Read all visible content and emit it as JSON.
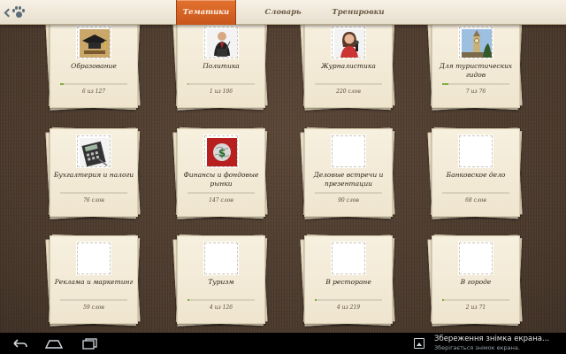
{
  "tabs": [
    {
      "label": "Тематики",
      "active": true
    },
    {
      "label": "Словарь",
      "active": false
    },
    {
      "label": "Тренировки",
      "active": false
    }
  ],
  "cards": [
    {
      "title": "Образование",
      "count": "6 из 127",
      "progress": 0.05,
      "icon": "graduation-cap-icon"
    },
    {
      "title": "Политика",
      "count": "1 из 106",
      "progress": 0.01,
      "icon": "politician-icon"
    },
    {
      "title": "Журналистика",
      "count": "220 слов",
      "progress": 0,
      "icon": "journalist-icon"
    },
    {
      "title": "Для туристических гидов",
      "count": "7 из 76",
      "progress": 0.09,
      "icon": "tower-icon"
    },
    {
      "title": "Бухгалтерия и налоги",
      "count": "76 слов",
      "progress": 0,
      "icon": "calculator-icon"
    },
    {
      "title": "Финансы и фондовые рынки",
      "count": "147 слов",
      "progress": 0,
      "icon": "dollar-globe-icon"
    },
    {
      "title": "Деловые встречи и презентации",
      "count": "90 слов",
      "progress": 0,
      "icon": "blank-stamp-icon"
    },
    {
      "title": "Банковское дело",
      "count": "68 слов",
      "progress": 0,
      "icon": "blank-stamp-icon"
    },
    {
      "title": "Реклама и маркетинг",
      "count": "59 слов",
      "progress": 0,
      "icon": "blank-stamp-icon"
    },
    {
      "title": "Туризм",
      "count": "4 из 126",
      "progress": 0.03,
      "icon": "blank-stamp-icon"
    },
    {
      "title": "В ресторане",
      "count": "4 из 219",
      "progress": 0.02,
      "icon": "blank-stamp-icon"
    },
    {
      "title": "В городе",
      "count": "2 из 71",
      "progress": 0.03,
      "icon": "blank-stamp-icon"
    }
  ],
  "notification": {
    "title": "Збереження знімка екрана...",
    "subtitle": "Зберігається знімок екрана."
  },
  "colors": {
    "active_tab": "#d8642a",
    "progress": "#7fb03d",
    "board": "#4e3d30",
    "paper": "#f3ead6"
  }
}
